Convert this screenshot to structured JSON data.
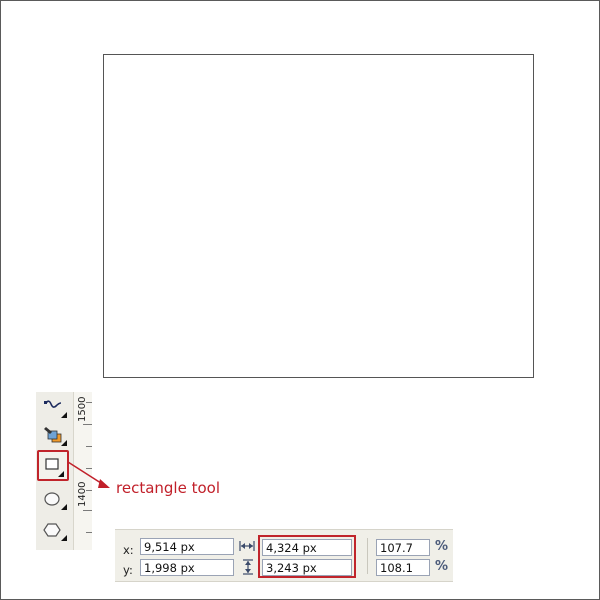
{
  "toolbox": {
    "tools": [
      {
        "name": "freehand",
        "icon": "freehand-curve-icon"
      },
      {
        "name": "smart-fill",
        "icon": "smart-fill-icon"
      },
      {
        "name": "rectangle",
        "icon": "rectangle-icon",
        "active": true
      },
      {
        "name": "ellipse",
        "icon": "ellipse-icon"
      },
      {
        "name": "polygon",
        "icon": "polygon-icon"
      }
    ]
  },
  "ruler": {
    "labels": [
      "1500",
      "1400"
    ]
  },
  "callout": {
    "text": "rectangle tool",
    "color": "#c1202a"
  },
  "property_bar": {
    "x_label": "x:",
    "y_label": "y:",
    "x_value": "9,514 px",
    "y_value": "1,998 px",
    "width_value": "4,324 px",
    "height_value": "3,243 px",
    "scale_x_value": "107.7",
    "scale_y_value": "108.1",
    "percent_symbol": "%",
    "width_icon": "horizontal-size-icon",
    "height_icon": "vertical-size-icon",
    "highlight_color": "#c0242b"
  }
}
